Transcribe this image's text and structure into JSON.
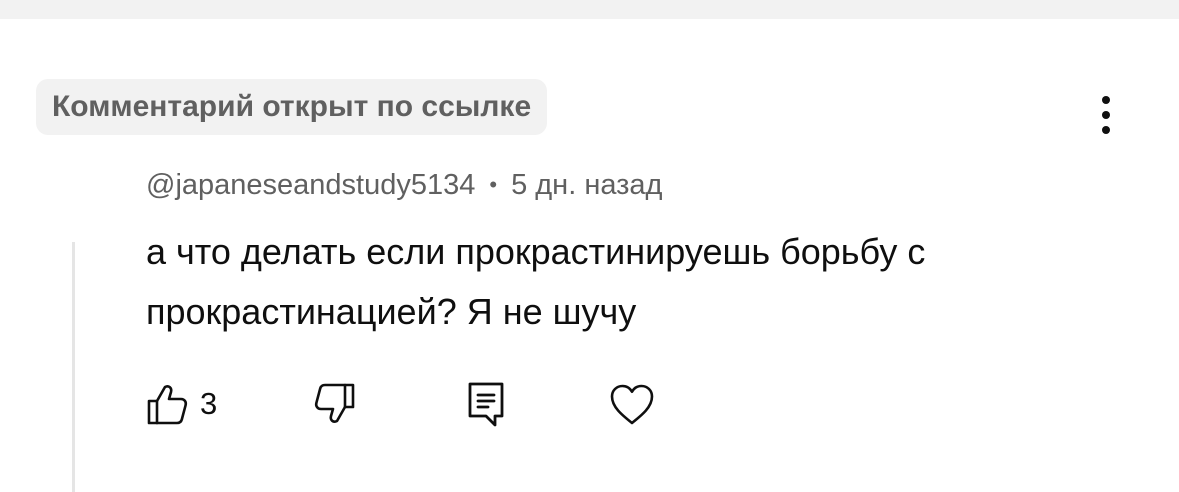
{
  "pinned_badge": {
    "label": "Комментарий открыт по ссылке"
  },
  "comment": {
    "author": "@japaneseandstudy5134",
    "separator": "•",
    "time": "5 дн. назад",
    "text": "а что делать если прокрастинируешь борьбу с прокрастинацией? Я не шучу",
    "like_count": "3"
  },
  "icons": {
    "more": "more-vertical-icon",
    "like": "thumb-up-icon",
    "dislike": "thumb-down-icon",
    "reply": "reply-comment-icon",
    "heart": "heart-icon"
  }
}
